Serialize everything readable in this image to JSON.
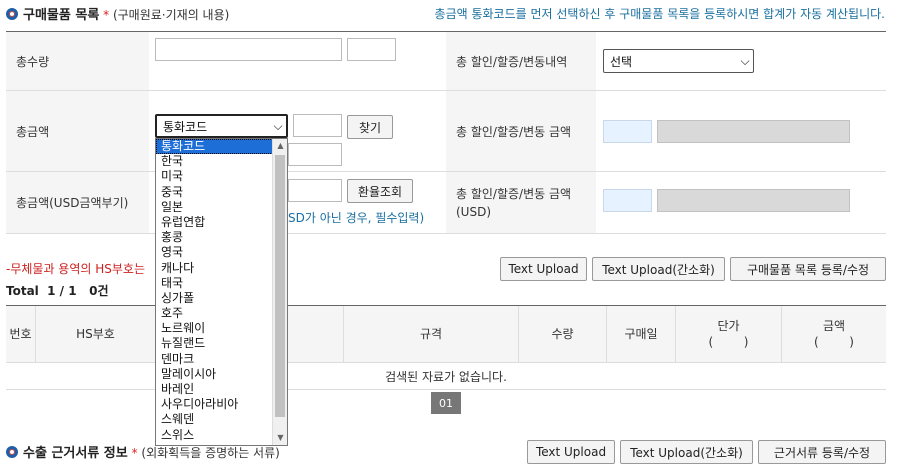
{
  "section1": {
    "title": "구매물품 목록",
    "required": "*",
    "subtitle": "(구매원료·기재의 내용)",
    "note": "총금액 통화코드를 먼저 선택하신 후 구매물품 목록을 등록하시면 합계가 자동 계산됩니다."
  },
  "form": {
    "total_qty_label": "총수량",
    "discount_label": "총 할인/할증/변동내역",
    "discount_select": "선택",
    "total_amount_label": "총금액",
    "currency_select": "통화코드",
    "find_button": "찾기",
    "discount_amount_label": "총 할인/할증/변동 금액",
    "usd_label": "총금액(USD금액부기)",
    "exchange_button": "환율조회",
    "usd_hint": "SD가 아닌 경우, 필수입력)",
    "discount_usd_label": "총 할인/할증/변동 금액 (USD)"
  },
  "hs_note": "-무체물과 용역의 HS부호는",
  "toolbar": {
    "upload": "Text Upload",
    "upload_simple": "Text Upload(간소화)",
    "register": "구매물품 목록 등록/수정"
  },
  "total": {
    "label": "Total",
    "page": "1 / 1",
    "count": "0건"
  },
  "grid": {
    "headers": [
      "번호",
      "HS부호",
      "",
      "규격",
      "수량",
      "구매일",
      "단가\n(        )",
      "금액\n(        )"
    ],
    "empty": "검색된 자료가 없습니다.",
    "page": "01"
  },
  "currency_options": [
    "통화코드",
    "한국",
    "미국",
    "중국",
    "일본",
    "유럽연합",
    "홍콩",
    "영국",
    "캐나다",
    "태국",
    "싱가폴",
    "호주",
    "노르웨이",
    "뉴질랜드",
    "덴마크",
    "말레이시아",
    "바레인",
    "사우디아라비아",
    "스웨덴",
    "스위스"
  ],
  "section2": {
    "title": "수출 근거서류 정보",
    "required": "*",
    "subtitle": "(외화획득을 증명하는 서류)",
    "upload": "Text Upload",
    "upload_simple": "Text Upload(간소화)",
    "register": "근거서류 등록/수정"
  },
  "colors": {
    "accent": "#1f5fa8",
    "note": "#1a6fa0",
    "required": "#dd2222",
    "hs_note": "#cc2222"
  }
}
